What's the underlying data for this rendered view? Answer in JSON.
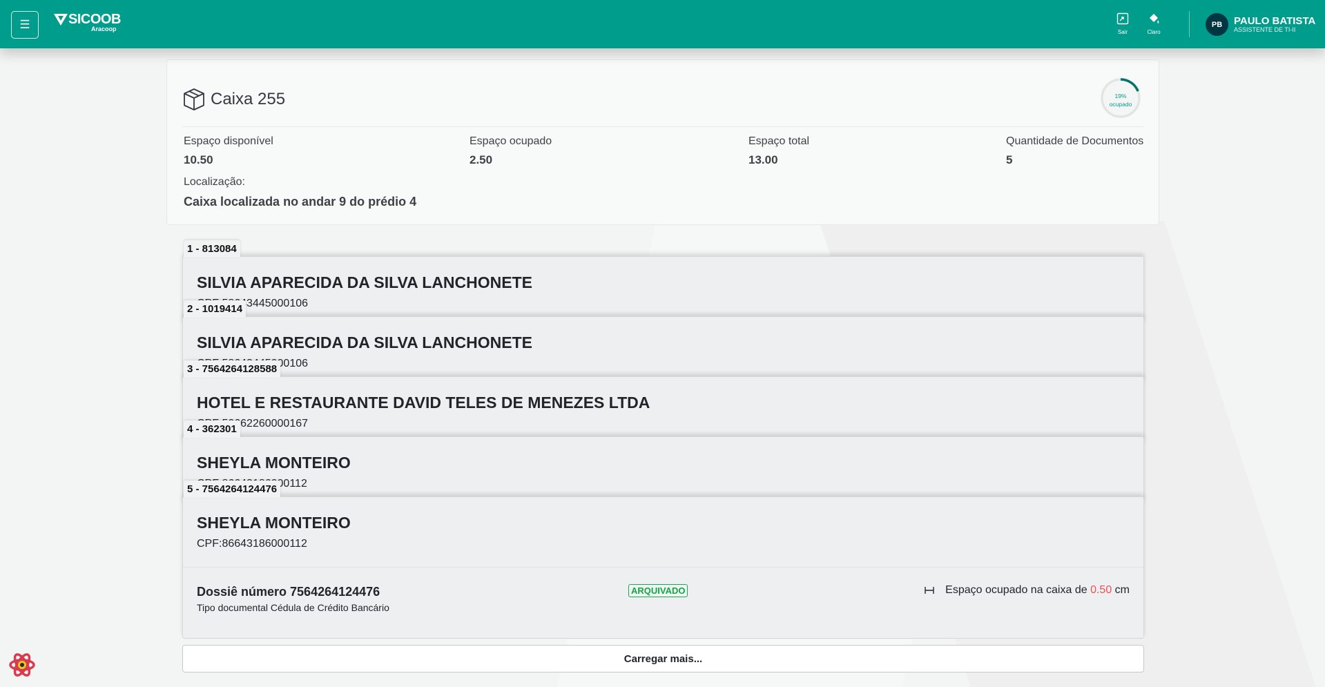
{
  "header": {
    "brand": "SICOOB",
    "brand_sub": "Aracoop",
    "menu_icon": "☰",
    "actions": [
      {
        "label": "Sair",
        "icon": "logout-icon"
      },
      {
        "label": "Claro",
        "icon": "paint-bucket-icon"
      }
    ],
    "user": {
      "initials": "PB",
      "name": "PAULO BATISTA",
      "role": "ASSISTENTE DE TI-II"
    }
  },
  "box": {
    "title": "Caixa 255",
    "occupancy_percent": 19,
    "occupancy_label": "19%",
    "occupancy_sub": "ocupado",
    "stats": [
      {
        "label": "Espaço disponível",
        "value": "10.50"
      },
      {
        "label": "Espaço ocupado",
        "value": "2.50"
      },
      {
        "label": "Espaço total",
        "value": "13.00"
      },
      {
        "label": "Quantidade de Documentos",
        "value": "5"
      }
    ],
    "location_label": "Localização:",
    "location_value": "Caixa localizada no andar 9 do prédio 4"
  },
  "documents": [
    {
      "tab": "1 - 813084",
      "name": "SILVIA APARECIDA DA SILVA LANCHONETE",
      "cpf": "CPF:58643445000106"
    },
    {
      "tab": "2 - 1019414",
      "name": "SILVIA APARECIDA DA SILVA LANCHONETE",
      "cpf": "CPF:58643445000106"
    },
    {
      "tab": "3 - 7564264128588",
      "name": "HOTEL E RESTAURANTE DAVID TELES DE MENEZES LTDA",
      "cpf": "CPF:50662260000167"
    },
    {
      "tab": "4 - 362301",
      "name": "SHEYLA MONTEIRO",
      "cpf": "CPF:86643186000112"
    },
    {
      "tab": "5 - 7564264124476",
      "name": "SHEYLA MONTEIRO",
      "cpf": "CPF:86643186000112"
    }
  ],
  "expanded": {
    "dossie": "Dossiê número 7564264124476",
    "tipo": "Tipo documental Cédula de Crédito Bancário",
    "status": "ARQUIVADO",
    "space_prefix": "Espaço ocupado na caixa de",
    "space_value": "0.50",
    "space_unit": "cm"
  },
  "load_more": "Carregar mais...",
  "colors": {
    "primary": "#009d8c",
    "dark": "#003641",
    "success": "#16a34a",
    "danger": "#e55353"
  }
}
